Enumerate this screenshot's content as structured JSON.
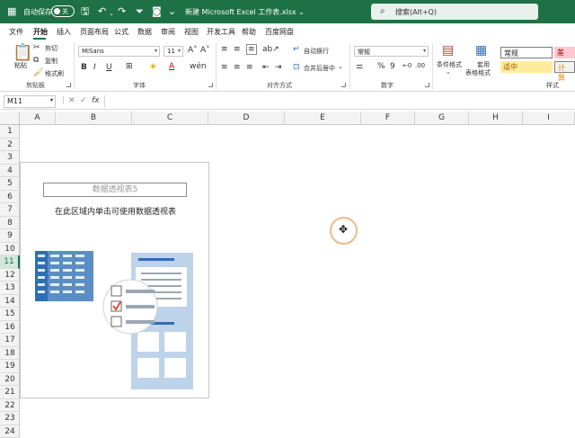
{
  "titlebar": {
    "autosave_label": "自动保存",
    "toggle_state": "关",
    "doc_title": "新建 Microsoft Excel 工作表.xlsx ⌄",
    "search_placeholder": "搜索(Alt+Q)"
  },
  "menu": [
    "文件",
    "开始",
    "插入",
    "页面布局",
    "公式",
    "数据",
    "审阅",
    "视图",
    "开发工具",
    "帮助",
    "百度网盘"
  ],
  "ribbon": {
    "clipboard": {
      "paste": "粘贴",
      "cut": "剪切",
      "copy": "复制",
      "format_painter": "格式刷",
      "label": "剪贴板"
    },
    "font": {
      "name": "MiSans",
      "size": "11",
      "label": "字体"
    },
    "alignment": {
      "wrap": "自动换行",
      "merge": "合并后居中",
      "label": "对齐方式"
    },
    "number": {
      "format": "常规",
      "label": "数字"
    },
    "styles": {
      "conditional": "条件格式",
      "table_fmt_1": "套用",
      "table_fmt_2": "表格格式",
      "normal": "常规",
      "bad": "差",
      "neutral": "适中",
      "calc": "计算",
      "label": "样式"
    }
  },
  "formula_bar": {
    "name_box": "M11",
    "fx": "fx"
  },
  "columns": [
    "A",
    "B",
    "C",
    "D",
    "E",
    "F",
    "G",
    "H",
    "I"
  ],
  "rows": [
    "1",
    "2",
    "3",
    "4",
    "5",
    "6",
    "7",
    "8",
    "9",
    "10",
    "11",
    "12",
    "13",
    "14",
    "15",
    "16",
    "17",
    "18",
    "19",
    "20",
    "21",
    "22",
    "23",
    "24"
  ],
  "selected_row": "11",
  "pivot": {
    "title": "数据透视表5",
    "message": "在此区域内单击可使用数据透视表"
  },
  "colors": {
    "brand": "#1e7145",
    "bad_fill": "#ffc7ce",
    "neutral_fill": "#ffeb9c",
    "calc_fill": "#f2f2f2"
  }
}
